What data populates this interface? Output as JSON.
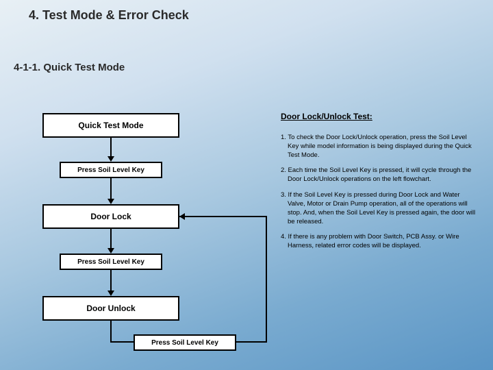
{
  "title": "4. Test Mode & Error Check",
  "subtitle": "4-1-1.  Quick Test Mode",
  "flow": {
    "quick": "Quick Test Mode",
    "press1": "Press Soil Level Key",
    "lock": "Door Lock",
    "press2": "Press Soil Level Key",
    "unlock": "Door Unlock",
    "press3": "Press Soil Level Key"
  },
  "right": {
    "heading": "Door Lock/Unlock Test:",
    "p1": "1. To check the Door Lock/Unlock operation, press the Soil Level Key while model information is being displayed during the Quick Test Mode.",
    "p2": "2. Each time the Soil Level Key is pressed, it will cycle through the Door Lock/Unlock operations on the left flowchart.",
    "p3": "3. If the Soil Level Key is pressed during Door Lock and Water Valve, Motor or Drain Pump operation, all of the operations will stop. And, when the Soil Level Key is pressed again, the door will be released.",
    "p4": "4. If there is any problem with Door Switch, PCB Assy. or Wire Harness, related error codes will be displayed."
  }
}
